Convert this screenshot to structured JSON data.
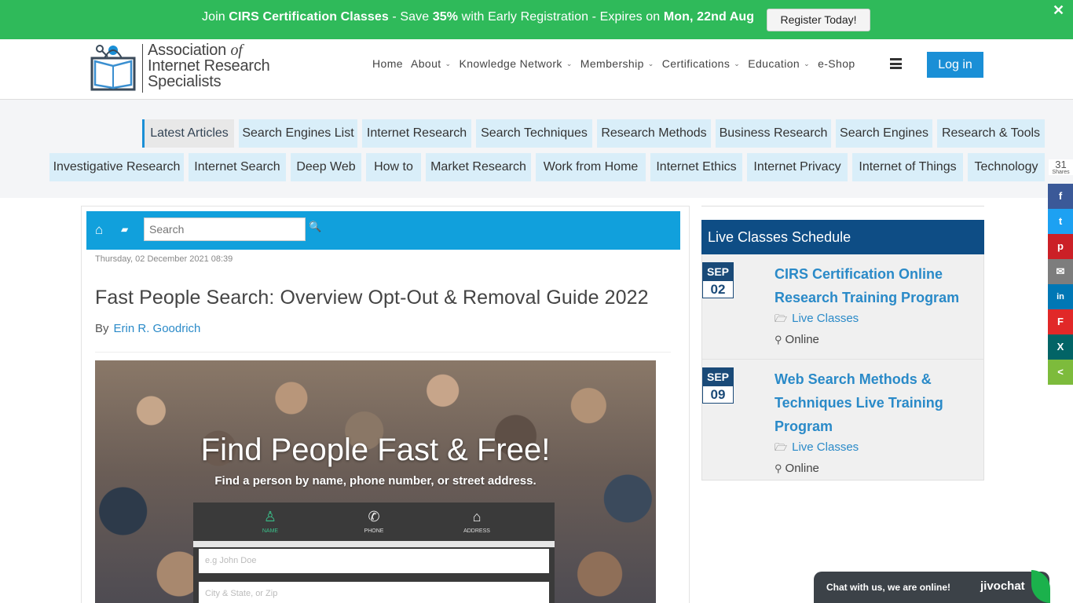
{
  "promo": {
    "join": "Join ",
    "classes": "CIRS Certification Classes",
    "save_prefix": " -  Save ",
    "percent": "35%",
    "mid": " with Early Registration - Expires on ",
    "date": "Mon, 22nd Aug",
    "button": "Register Today!",
    "close": "✕"
  },
  "logo": {
    "line1": "Association ",
    "of": "of",
    "line2": "Internet Research",
    "line3": "Specialists"
  },
  "nav": {
    "items": [
      {
        "label": "Home",
        "dropdown": false
      },
      {
        "label": "About",
        "dropdown": true
      },
      {
        "label": "Knowledge Network",
        "dropdown": true
      },
      {
        "label": "Membership",
        "dropdown": true
      },
      {
        "label": "Certifications",
        "dropdown": true
      },
      {
        "label": "Education",
        "dropdown": true
      },
      {
        "label": "e-Shop",
        "dropdown": false
      }
    ],
    "caret": "⌄",
    "login": "Log in"
  },
  "tags": {
    "row1": [
      "Latest Articles",
      "Search Engines List",
      "Internet Research",
      "Search Techniques",
      "Research Methods",
      "Business Research",
      "Search Engines",
      "Research & Tools"
    ],
    "row2": [
      "Investigative Research",
      "Internet Search",
      "Deep Web",
      "How to",
      "Market Research",
      "Work from Home",
      "Internet Ethics",
      "Internet Privacy",
      "Internet of Things",
      "Technology"
    ]
  },
  "share": {
    "count": "31",
    "label": "Shares",
    "buttons": [
      {
        "name": "facebook-share-button",
        "glyph": "f",
        "color": "#3b5998"
      },
      {
        "name": "twitter-share-button",
        "glyph": "t",
        "color": "#1da1f2"
      },
      {
        "name": "pinterest-share-button",
        "glyph": "p",
        "color": "#cb2027"
      },
      {
        "name": "email-share-button",
        "glyph": "✉",
        "color": "#7d7d7d"
      },
      {
        "name": "linkedin-share-button",
        "glyph": "in",
        "color": "#0077b5"
      },
      {
        "name": "flipboard-share-button",
        "glyph": "F",
        "color": "#e12828"
      },
      {
        "name": "xing-share-button",
        "glyph": "X",
        "color": "#026466"
      },
      {
        "name": "sharethis-share-button",
        "glyph": "<",
        "color": "#7dbb3c"
      }
    ]
  },
  "toolbar": {
    "home_icon": "⌂",
    "folder_icon": "▰",
    "search_placeholder": "Search",
    "search_icon": "🔍"
  },
  "article": {
    "date": "Thursday, 02 December 2021 08:39",
    "title": "Fast People Search: Overview Opt-Out & Removal Guide 2022",
    "by": "By",
    "author": "Erin R. Goodrich"
  },
  "hero": {
    "headline": "Find People Fast & Free!",
    "sub": "Find a person by name, phone number, or street address.",
    "tabs": [
      {
        "icon": "♙",
        "label": "NAME"
      },
      {
        "icon": "✆",
        "label": "PHONE"
      },
      {
        "icon": "⌂",
        "label": "ADDRESS"
      }
    ],
    "field1": "e.g John Doe",
    "field2": "City & State, or Zip"
  },
  "schedule": {
    "heading": "Live Classes Schedule",
    "events": [
      {
        "month": "SEP",
        "day": "02",
        "title": "CIRS Certification Online Research Training Program",
        "category": "Live Classes",
        "location": "Online"
      },
      {
        "month": "SEP",
        "day": "09",
        "title": "Web Search Methods & Techniques Live Training Program",
        "category": "Live Classes",
        "location": "Online"
      }
    ],
    "folder_icon": "🗁",
    "pin_icon": "⚲"
  },
  "chat": {
    "text": "Chat with us, we are online!",
    "brand": "jivochat"
  },
  "colors": {
    "promo": "#2fba5a",
    "accent": "#1a8fd6",
    "toolbar": "#11a0dc",
    "schedule_header": "#0e4d85"
  }
}
